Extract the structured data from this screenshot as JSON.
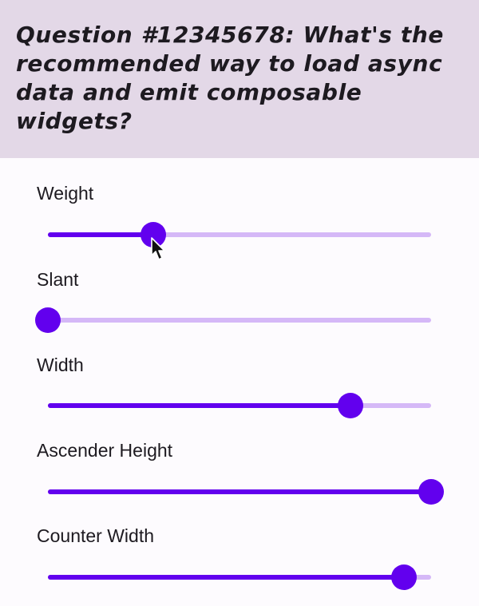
{
  "question": "Question #12345678: What's the recommended way to load async data and emit composable widgets?",
  "colors": {
    "header_bg": "#e3d8e7",
    "accent": "#6200ee",
    "track_inactive": "#d5b8f7",
    "text": "#1d1a20"
  },
  "sliders": [
    {
      "label": "Weight",
      "value": 0.275
    },
    {
      "label": "Slant",
      "value": 0.0
    },
    {
      "label": "Width",
      "value": 0.79
    },
    {
      "label": "Ascender Height",
      "value": 1.0
    },
    {
      "label": "Counter Width",
      "value": 0.93
    }
  ],
  "cursor_icon": "mouse-pointer-icon"
}
